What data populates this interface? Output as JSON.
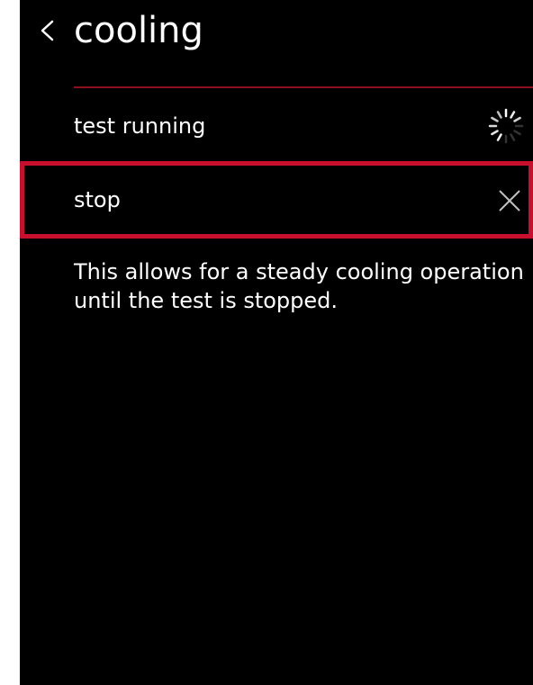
{
  "header": {
    "back_icon": "chevron-left-icon",
    "title": "cooling"
  },
  "status_row": {
    "label": "test running",
    "icon": "loading-spinner-icon"
  },
  "stop_row": {
    "label": "stop",
    "icon": "close-icon",
    "highlight_color": "#c8102e"
  },
  "description": "This allows for a steady cooling operation until the test is stopped.",
  "colors": {
    "background": "#000000",
    "text": "#ffffff",
    "accent": "#c8102e"
  }
}
